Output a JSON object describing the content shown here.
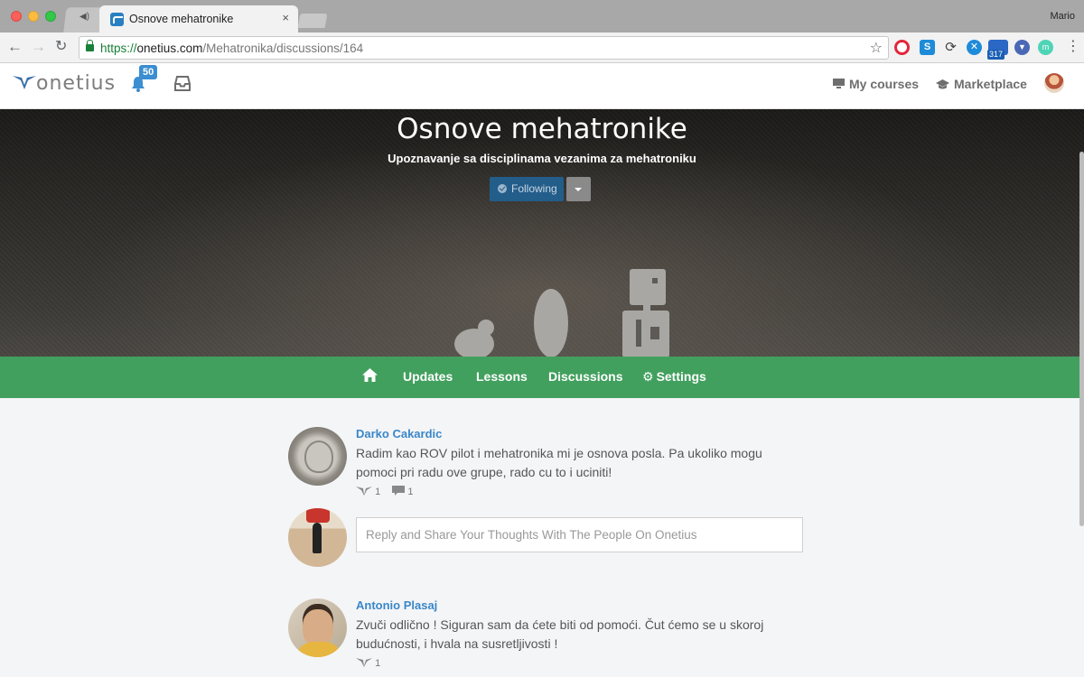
{
  "browser": {
    "tab_title": "Osnove mehatronike",
    "tab_close": "×",
    "profile_name": "Mario",
    "url_protocol": "https://",
    "url_domain": "onetius.com",
    "url_path": "/Mehatronika/discussions/164",
    "extension_badge": "317"
  },
  "header": {
    "logo_text": "onetius",
    "notifications_count": "50",
    "my_courses_label": "My courses",
    "marketplace_label": "Marketplace"
  },
  "hero": {
    "title": "Osnove mehatronike",
    "subtitle": "Upoznavanje sa disciplinama vezanima za mehatroniku",
    "following_label": "Following"
  },
  "course_nav": {
    "updates": "Updates",
    "lessons": "Lessons",
    "discussions": "Discussions",
    "settings": "Settings"
  },
  "posts": [
    {
      "author": "Darko Cakardic",
      "text": "Radim kao ROV pilot i mehatronika mi je osnova posla. Pa ukoliko mogu pomoci pri radu ove grupe, rado cu to i uciniti!",
      "likes": "1",
      "comments": "1"
    },
    {
      "author": "Antonio Plasaj",
      "text": "Zvuči odlično ! Siguran sam da ćete biti od pomoći. Čut ćemo se u skoroj budućnosti, i hvala na susretljivosti !",
      "likes": "1"
    }
  ],
  "reply": {
    "placeholder": "Reply and Share Your Thoughts With The People On Onetius"
  },
  "colors": {
    "nav_green": "#42a05e",
    "link_blue": "#3a87c9",
    "following_blue": "#235d8a"
  }
}
